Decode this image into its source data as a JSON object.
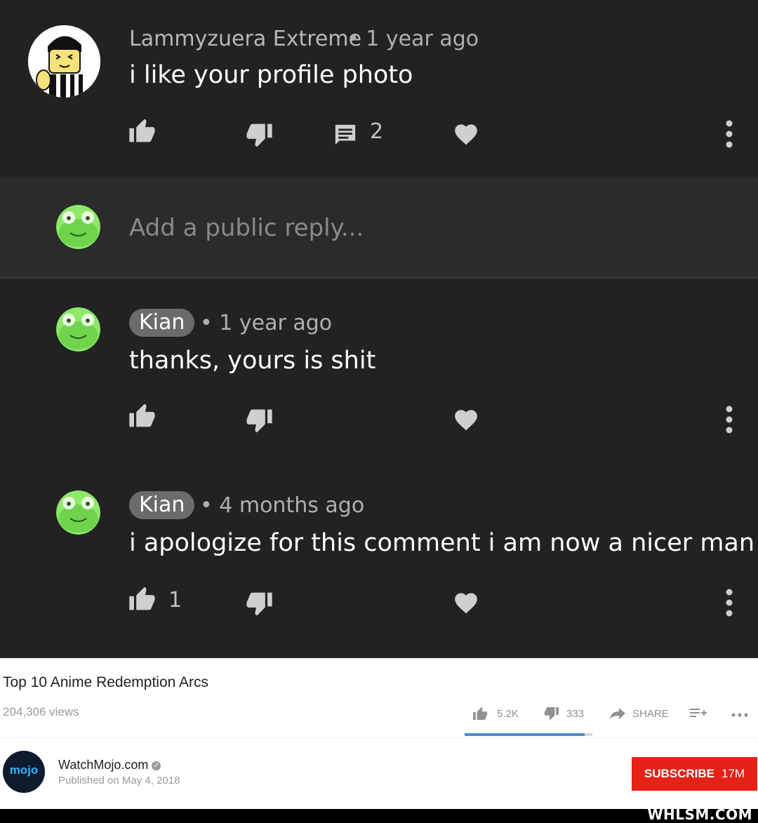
{
  "comments": [
    {
      "author": "Lammyzuera Extreme",
      "time": "• 1 year ago",
      "text": "i like your profile photo",
      "like_count": "",
      "reply_count": "2"
    },
    {
      "author": "Kian",
      "time": "• 1 year ago",
      "text": "thanks, yours is shit",
      "like_count": ""
    },
    {
      "author": "Kian",
      "time": "• 4 months ago",
      "text": "i apologize for this comment i am now a nicer man",
      "like_count": "1"
    }
  ],
  "reply_box": {
    "placeholder": "Add a public reply..."
  },
  "video": {
    "title": "Top 10 Anime Redemption Arcs",
    "views": "204,306 views",
    "likes": "5.2K",
    "dislikes": "333",
    "share": "SHARE",
    "like_ratio": 0.94
  },
  "channel": {
    "name": "WatchMojo.com",
    "published": "Published on May 4, 2018",
    "logo_text": "mojo",
    "subscribe_label": "SUBSCRIBE",
    "subscriber_count": "17M"
  },
  "watermark": "WHLSM.COM",
  "colors": {
    "dark_bg": "#222222",
    "subscribe_red": "#e62117",
    "ratio_blue": "#4a8bd6",
    "avatar_green": "#7de05a"
  }
}
